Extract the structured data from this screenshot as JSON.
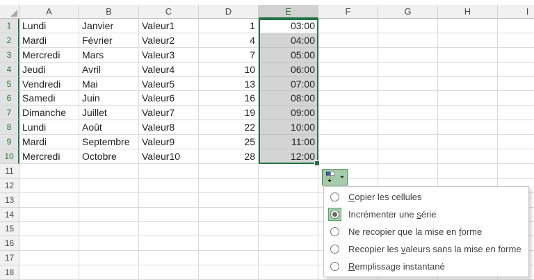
{
  "sheet": {
    "columns": [
      "A",
      "B",
      "C",
      "D",
      "E",
      "F",
      "G",
      "H",
      "I"
    ],
    "row_numbers": [
      "1",
      "2",
      "3",
      "4",
      "5",
      "6",
      "7",
      "8",
      "9",
      "10",
      "11",
      "12",
      "13",
      "14",
      "15",
      "16",
      "17",
      "18"
    ],
    "cell_rows": [
      [
        "Lundi",
        "Janvier",
        "Valeur1",
        "1",
        "03:00"
      ],
      [
        "Mardi",
        "Février",
        "Valeur2",
        "4",
        "04:00"
      ],
      [
        "Mercredi",
        "Mars",
        "Valeur3",
        "7",
        "05:00"
      ],
      [
        "Jeudi",
        "Avril",
        "Valeur4",
        "10",
        "06:00"
      ],
      [
        "Vendredi",
        "Mai",
        "Valeur5",
        "13",
        "07:00"
      ],
      [
        "Samedi",
        "Juin",
        "Valeur6",
        "16",
        "08:00"
      ],
      [
        "Dimanche",
        "Juillet",
        "Valeur7",
        "19",
        "09:00"
      ],
      [
        "Lundi",
        "Août",
        "Valeur8",
        "22",
        "10:00"
      ],
      [
        "Mardi",
        "Septembre",
        "Valeur9",
        "25",
        "11:00"
      ],
      [
        "Mercredi",
        "Octobre",
        "Valeur10",
        "28",
        "12:00"
      ]
    ],
    "selection": {
      "column": "E",
      "row_from": 1,
      "row_to": 10,
      "active_cell": "E1",
      "active_row": 1
    }
  },
  "fill_menu": {
    "items": [
      {
        "pre": "",
        "accel": "C",
        "post": "opier les cellules",
        "selected": false
      },
      {
        "pre": "Incrémenter une ",
        "accel": "s",
        "post": "érie",
        "selected": true
      },
      {
        "pre": "Ne recopier que la mise en ",
        "accel": "f",
        "post": "orme",
        "selected": false
      },
      {
        "pre": "Recopier les ",
        "accel": "v",
        "post": "aleurs sans la mise en forme",
        "selected": false
      },
      {
        "pre": "",
        "accel": "R",
        "post": "emplissage instantané",
        "selected": false
      }
    ]
  },
  "colors": {
    "excel_green": "#217346",
    "selection_fill": "#d4d4d4",
    "column_header_selected_bg": "#d2d2d2",
    "row_header_selected_bg": "#e2e2e2",
    "header_bg": "#f1f1f1",
    "gridline": "#dadada",
    "fill_button_bg": "#a6cda9",
    "fill_button_border": "#4f8d56",
    "menu_border": "#c6c6c6",
    "menu_highlight_bg": "#9ed3a6",
    "menu_highlight_border": "#5d9e66",
    "icon_cell_blue": "#3a66ad"
  }
}
